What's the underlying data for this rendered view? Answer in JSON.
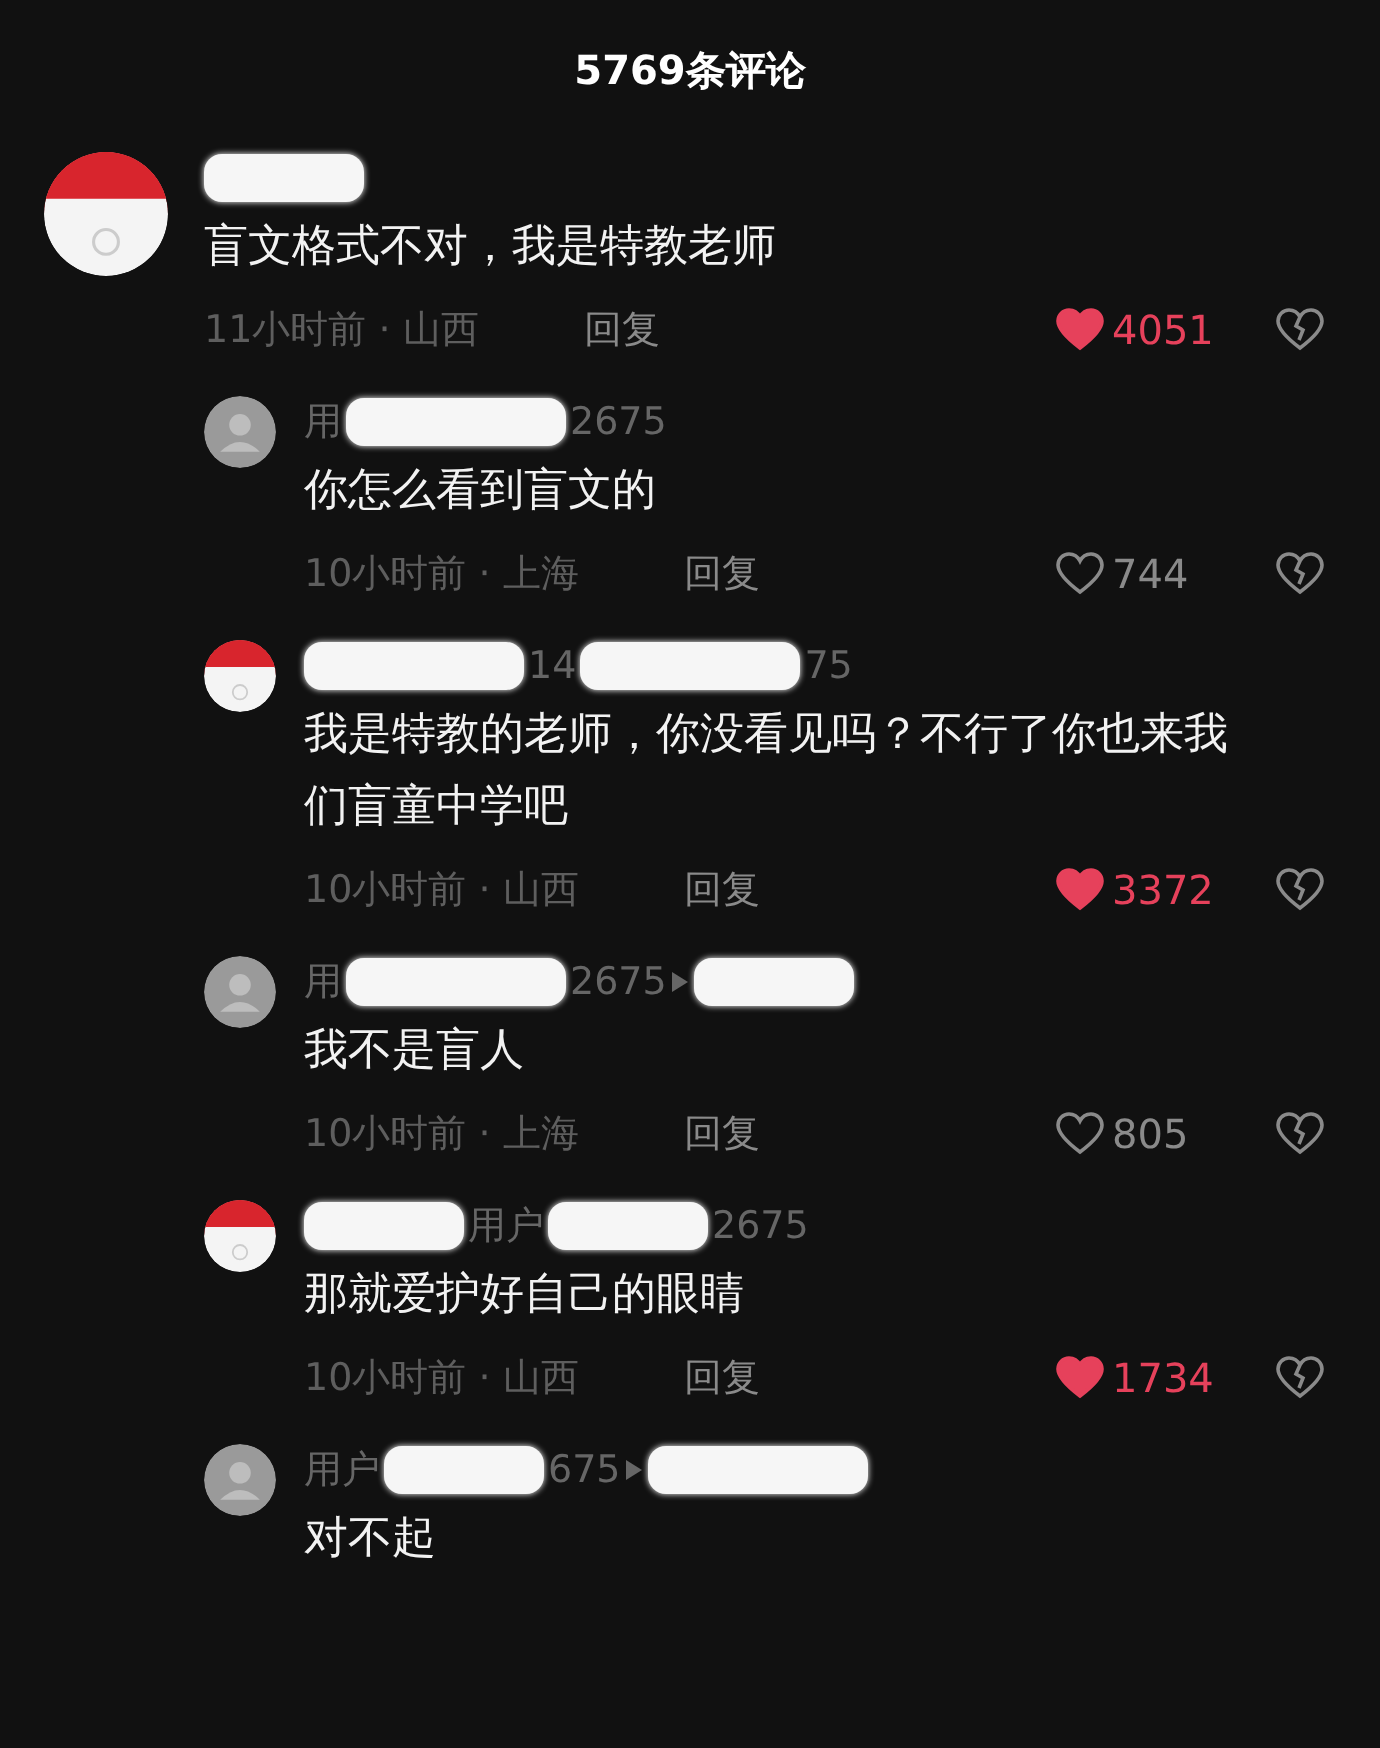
{
  "title": "5769条评论",
  "comments": [
    {
      "avatar": {
        "kind": "badge"
      },
      "name_parts": [
        {
          "kind": "redacted_short"
        }
      ],
      "text": "盲文格式不对，我是特教老师",
      "time": "11小时前 · 山西",
      "reply": "回复",
      "likes": "4051",
      "liked": true,
      "replies": [
        {
          "avatar": {
            "kind": "default"
          },
          "name_parts": [
            {
              "kind": "text",
              "text": "用"
            },
            {
              "kind": "redacted_long"
            },
            {
              "kind": "text",
              "text": "2675"
            }
          ],
          "text": "你怎么看到盲文的",
          "time": "10小时前 · 上海",
          "reply": "回复",
          "likes": "744",
          "liked": false
        },
        {
          "avatar": {
            "kind": "badge"
          },
          "name_parts": [
            {
              "kind": "redacted_long"
            },
            {
              "kind": "text",
              "text": "14"
            },
            {
              "kind": "redacted_long"
            },
            {
              "kind": "text",
              "text": "75"
            }
          ],
          "text": "我是特教的老师，你没看见吗？不行了你也来我们盲童中学吧",
          "time": "10小时前 · 山西",
          "reply": "回复",
          "likes": "3372",
          "liked": true
        },
        {
          "avatar": {
            "kind": "default"
          },
          "name_parts": [
            {
              "kind": "text",
              "text": "用"
            },
            {
              "kind": "redacted_long"
            },
            {
              "kind": "text",
              "text": "2675"
            },
            {
              "kind": "arrow"
            },
            {
              "kind": "redacted_short"
            }
          ],
          "text": "我不是盲人",
          "time": "10小时前 · 上海",
          "reply": "回复",
          "likes": "805",
          "liked": false
        },
        {
          "avatar": {
            "kind": "badge"
          },
          "name_parts": [
            {
              "kind": "redacted_short"
            },
            {
              "kind": "text",
              "text": "用户"
            },
            {
              "kind": "redacted_short"
            },
            {
              "kind": "text",
              "text": "2675"
            }
          ],
          "text": "那就爱护好自己的眼睛",
          "time": "10小时前 · 山西",
          "reply": "回复",
          "likes": "1734",
          "liked": true
        },
        {
          "avatar": {
            "kind": "default"
          },
          "name_parts": [
            {
              "kind": "text",
              "text": "用户"
            },
            {
              "kind": "redacted_short"
            },
            {
              "kind": "text",
              "text": "675"
            },
            {
              "kind": "arrow"
            },
            {
              "kind": "redacted_long"
            }
          ],
          "text": "对不起"
        }
      ]
    }
  ]
}
